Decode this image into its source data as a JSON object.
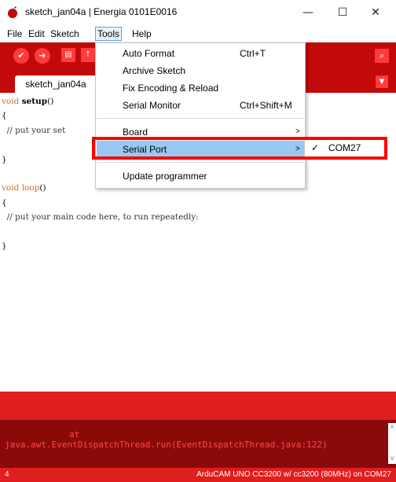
{
  "window": {
    "title": "sketch_jan04a | Energia 0101E0016",
    "minimize": "—",
    "maximize": "☐",
    "close": "✕",
    "icon": "energia-logo-icon"
  },
  "menubar": {
    "file": "File",
    "edit": "Edit",
    "sketch": "Sketch",
    "tools": "Tools",
    "help": "Help"
  },
  "toolbar": {
    "verify_icon": "check-icon",
    "upload_icon": "arrow-right-icon",
    "new_icon": "new-file-icon",
    "open_icon": "open-icon",
    "serial_monitor_icon": "magnifier-icon"
  },
  "tabs": {
    "active": "sketch_jan04a"
  },
  "editor": {
    "line1_kw": "void",
    "line1_fn": "setup",
    "line1_rest": "()",
    "line2": "{",
    "line3": "  // put your set",
    "line5": "}",
    "line7_kw": "void",
    "line7_fn": "loop",
    "line7_rest": "()",
    "line8": "{",
    "line9": "  // put your main code here, to run repeatedly:",
    "line11": "}"
  },
  "console": {
    "line1": "at",
    "line2": "java.awt.EventDispatchThread.run(EventDispatchThread.java:122)"
  },
  "statusbar": {
    "line_number": "4",
    "board": "ArduCAM UNO CC3200 w/ cc3200 (80MHz) on COM27"
  },
  "tools_menu": {
    "auto_format": "Auto Format",
    "auto_format_shortcut": "Ctrl+T",
    "archive_sketch": "Archive Sketch",
    "fix_encoding": "Fix Encoding & Reload",
    "serial_monitor": "Serial Monitor",
    "serial_monitor_shortcut": "Ctrl+Shift+M",
    "board": "Board",
    "serial_port": "Serial Port",
    "update_programmer": "Update programmer",
    "submenu_arrow": ">"
  },
  "serial_port_submenu": {
    "check": "✓",
    "port": "COM27"
  },
  "colors": {
    "accent_red": "#c20a0a",
    "console_bg": "#8a0a0a",
    "highlight_blue": "#99c8f2",
    "annotation_red": "#ff0000"
  }
}
